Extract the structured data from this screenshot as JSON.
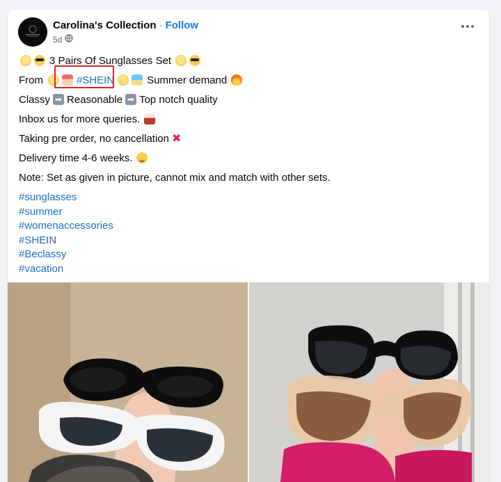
{
  "post": {
    "author": "Carolina's Collection",
    "separator": "·",
    "follow_label": "Follow",
    "time": "5d",
    "privacy_icon": "globe-icon",
    "more_icon": "more-options-icon"
  },
  "body": {
    "line1": {
      "text": "3 Pairs Of Sunglasses Set"
    },
    "line2": {
      "prefix": "From",
      "hashtag": "#SHEIN",
      "suffix": "Summer demand"
    },
    "line3": {
      "word1": "Classy",
      "word2": "Reasonable",
      "word3": "Top notch quality"
    },
    "line4": "Inbox us for more queries.",
    "line5": "Taking pre order, no cancellation",
    "line6": "Delivery time 4-6 weeks.",
    "line7": "Note: Set as given in picture, cannot mix and match with other sets."
  },
  "hashtags": [
    "#sunglasses",
    "#summer",
    "#womenaccessories",
    "#SHEIN",
    "#Beclassy",
    "#vacation"
  ],
  "colors": {
    "link": "#1c6fc6",
    "follow": "#1877f2",
    "highlight_box": "#e02020"
  },
  "images": [
    {
      "name": "sunglasses-photo-left",
      "description_icon": "photo"
    },
    {
      "name": "sunglasses-photo-right",
      "description_icon": "photo"
    }
  ]
}
